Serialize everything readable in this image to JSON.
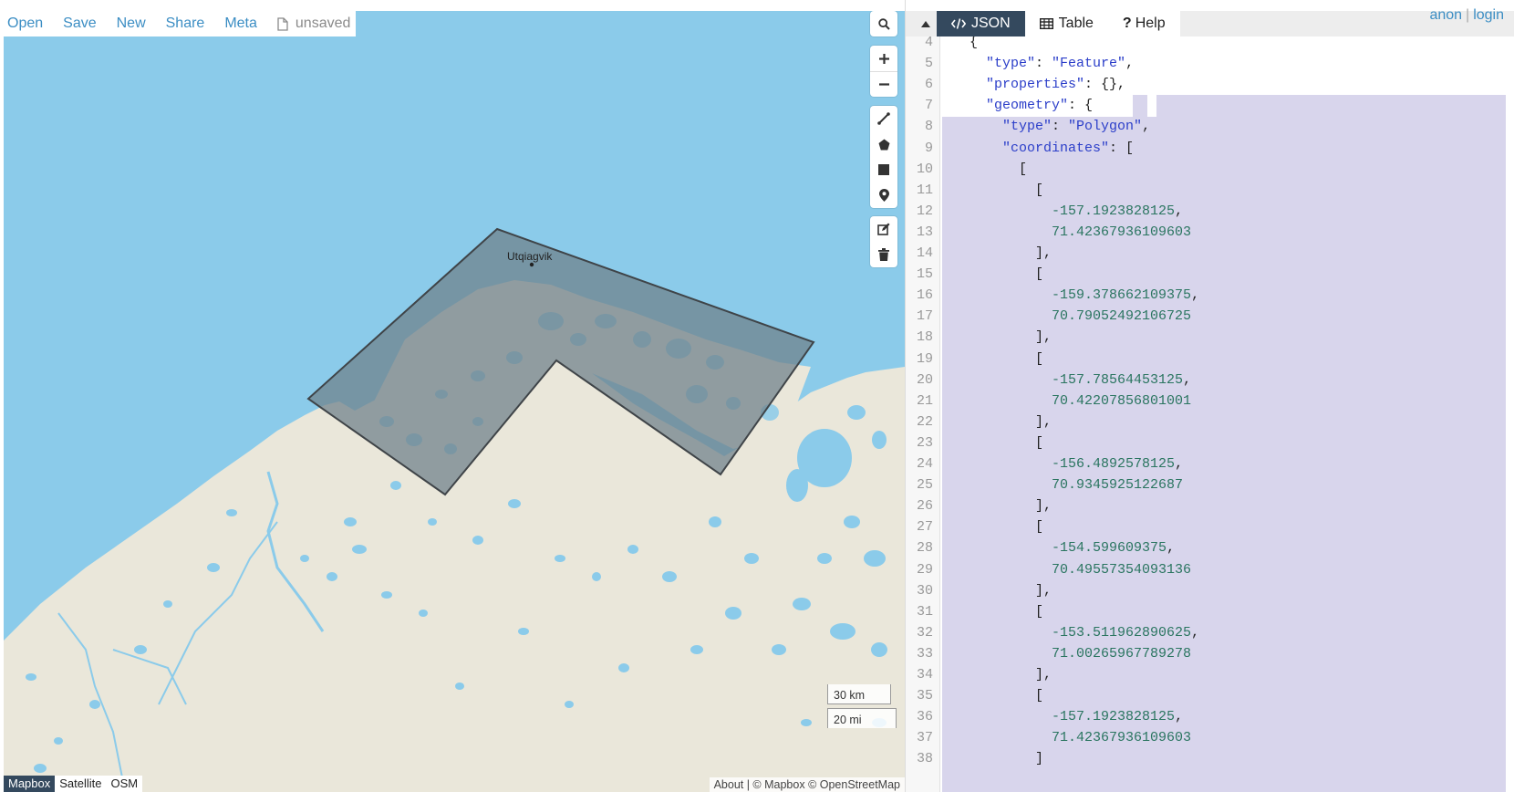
{
  "file_menu": {
    "items": [
      "Open",
      "Save",
      "New",
      "Share",
      "Meta"
    ],
    "status": "unsaved"
  },
  "map": {
    "place_label": "Utqiagvik",
    "scale_km": "30 km",
    "scale_mi": "20 mi",
    "basemaps": [
      "Mapbox",
      "Satellite",
      "OSM"
    ],
    "active_basemap": "Mapbox",
    "attribution": "About | © Mapbox © OpenStreetMap",
    "water_color": "#8bcbea",
    "land_color": "#eae7da",
    "polygon_fill": "#6e7f89"
  },
  "map_controls": {
    "search": "search-icon",
    "zoom": [
      "plus-icon",
      "minus-icon"
    ],
    "draw": [
      "line-icon",
      "polygon-icon",
      "rectangle-icon",
      "marker-icon"
    ],
    "edit": [
      "edit-icon",
      "trash-icon"
    ]
  },
  "pane": {
    "tabs": [
      {
        "label": "JSON",
        "icon": "code-icon",
        "active": true
      },
      {
        "label": "Table",
        "icon": "table-icon",
        "active": false
      },
      {
        "label": "Help",
        "icon": "question-icon",
        "active": false
      }
    ],
    "auth": {
      "anon": "anon",
      "login": "login"
    }
  },
  "editor": {
    "lines": [
      {
        "n": "4",
        "t": "  {"
      },
      {
        "n": "5",
        "t": "    \"type\": \"Feature\","
      },
      {
        "n": "6",
        "t": "    \"properties\": {},"
      },
      {
        "n": "7",
        "t": "    \"geometry\": {"
      },
      {
        "n": "8",
        "t": "      \"type\": \"Polygon\","
      },
      {
        "n": "9",
        "t": "      \"coordinates\": ["
      },
      {
        "n": "10",
        "t": "        ["
      },
      {
        "n": "11",
        "t": "          ["
      },
      {
        "n": "12",
        "t": "            -157.1923828125,"
      },
      {
        "n": "13",
        "t": "            71.42367936109603"
      },
      {
        "n": "14",
        "t": "          ],"
      },
      {
        "n": "15",
        "t": "          ["
      },
      {
        "n": "16",
        "t": "            -159.378662109375,"
      },
      {
        "n": "17",
        "t": "            70.79052492106725"
      },
      {
        "n": "18",
        "t": "          ],"
      },
      {
        "n": "19",
        "t": "          ["
      },
      {
        "n": "20",
        "t": "            -157.78564453125,"
      },
      {
        "n": "21",
        "t": "            70.42207856801001"
      },
      {
        "n": "22",
        "t": "          ],"
      },
      {
        "n": "23",
        "t": "          ["
      },
      {
        "n": "24",
        "t": "            -156.4892578125,"
      },
      {
        "n": "25",
        "t": "            70.9345925122687"
      },
      {
        "n": "26",
        "t": "          ],"
      },
      {
        "n": "27",
        "t": "          ["
      },
      {
        "n": "28",
        "t": "            -154.599609375,"
      },
      {
        "n": "29",
        "t": "            70.49557354093136"
      },
      {
        "n": "30",
        "t": "          ],"
      },
      {
        "n": "31",
        "t": "          ["
      },
      {
        "n": "32",
        "t": "            -153.511962890625,"
      },
      {
        "n": "33",
        "t": "            71.00265967789278"
      },
      {
        "n": "34",
        "t": "          ],"
      },
      {
        "n": "35",
        "t": "          ["
      },
      {
        "n": "36",
        "t": "            -157.1923828125,"
      },
      {
        "n": "37",
        "t": "            71.42367936109603"
      },
      {
        "n": "38",
        "t": "          ]"
      }
    ]
  }
}
